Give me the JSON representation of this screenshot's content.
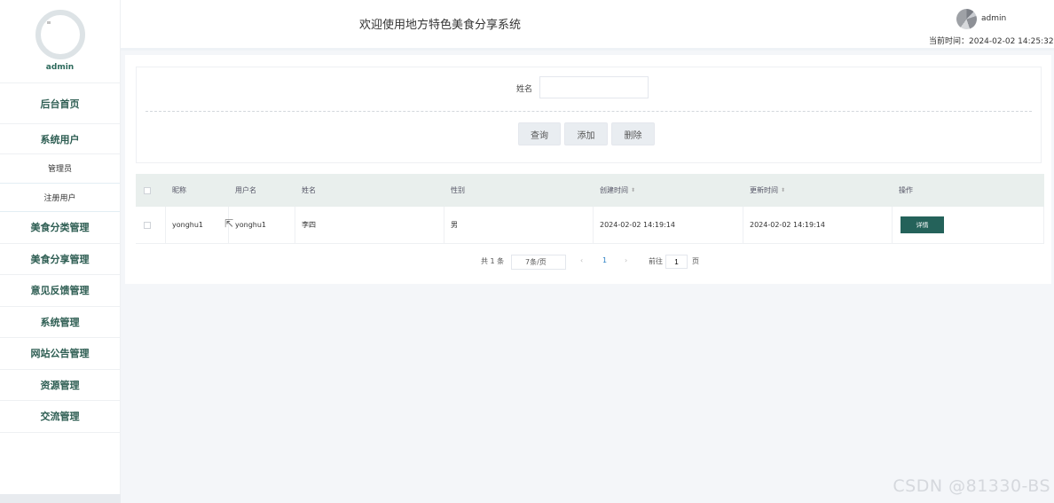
{
  "sidebar": {
    "username": "admin",
    "menu": {
      "home": "后台首页",
      "system_users": "系统用户",
      "admins": "管理员",
      "registered_users": "注册用户",
      "food_category": "美食分类管理",
      "food_share": "美食分享管理",
      "feedback": "意见反馈管理",
      "system_manage": "系统管理",
      "announcement": "网站公告管理",
      "resources": "资源管理",
      "exchange": "交流管理"
    }
  },
  "header": {
    "title": "欢迎使用地方特色美食分享系统",
    "user": "admin",
    "current_time": "当前时间：2024-02-02 14:25:32"
  },
  "search": {
    "name_label": "姓名",
    "name_value": "",
    "query_button": "查询",
    "add_button": "添加",
    "delete_button": "删除"
  },
  "table": {
    "columns": [
      "昵称",
      "用户名",
      "姓名",
      "性别",
      "创建时间",
      "更新时间",
      "操作"
    ],
    "rows": [
      {
        "nickname": "yonghu1",
        "username": "yonghu1",
        "name": "李四",
        "gender": "男",
        "created": "2024-02-02 14:19:14",
        "updated": "2024-02-02 14:19:14",
        "action": "详情"
      }
    ]
  },
  "pager": {
    "total": "共 1 条",
    "page_size": "7条/页",
    "prev": "‹",
    "current": "1",
    "next": "›",
    "goto_label": "前往",
    "goto_value": "1",
    "page_suffix": "页"
  },
  "watermark": "CSDN @81330-BS",
  "colors": {
    "accent": "#24625a",
    "menu_text": "#2d5d52",
    "table_header": "#e9efed"
  }
}
